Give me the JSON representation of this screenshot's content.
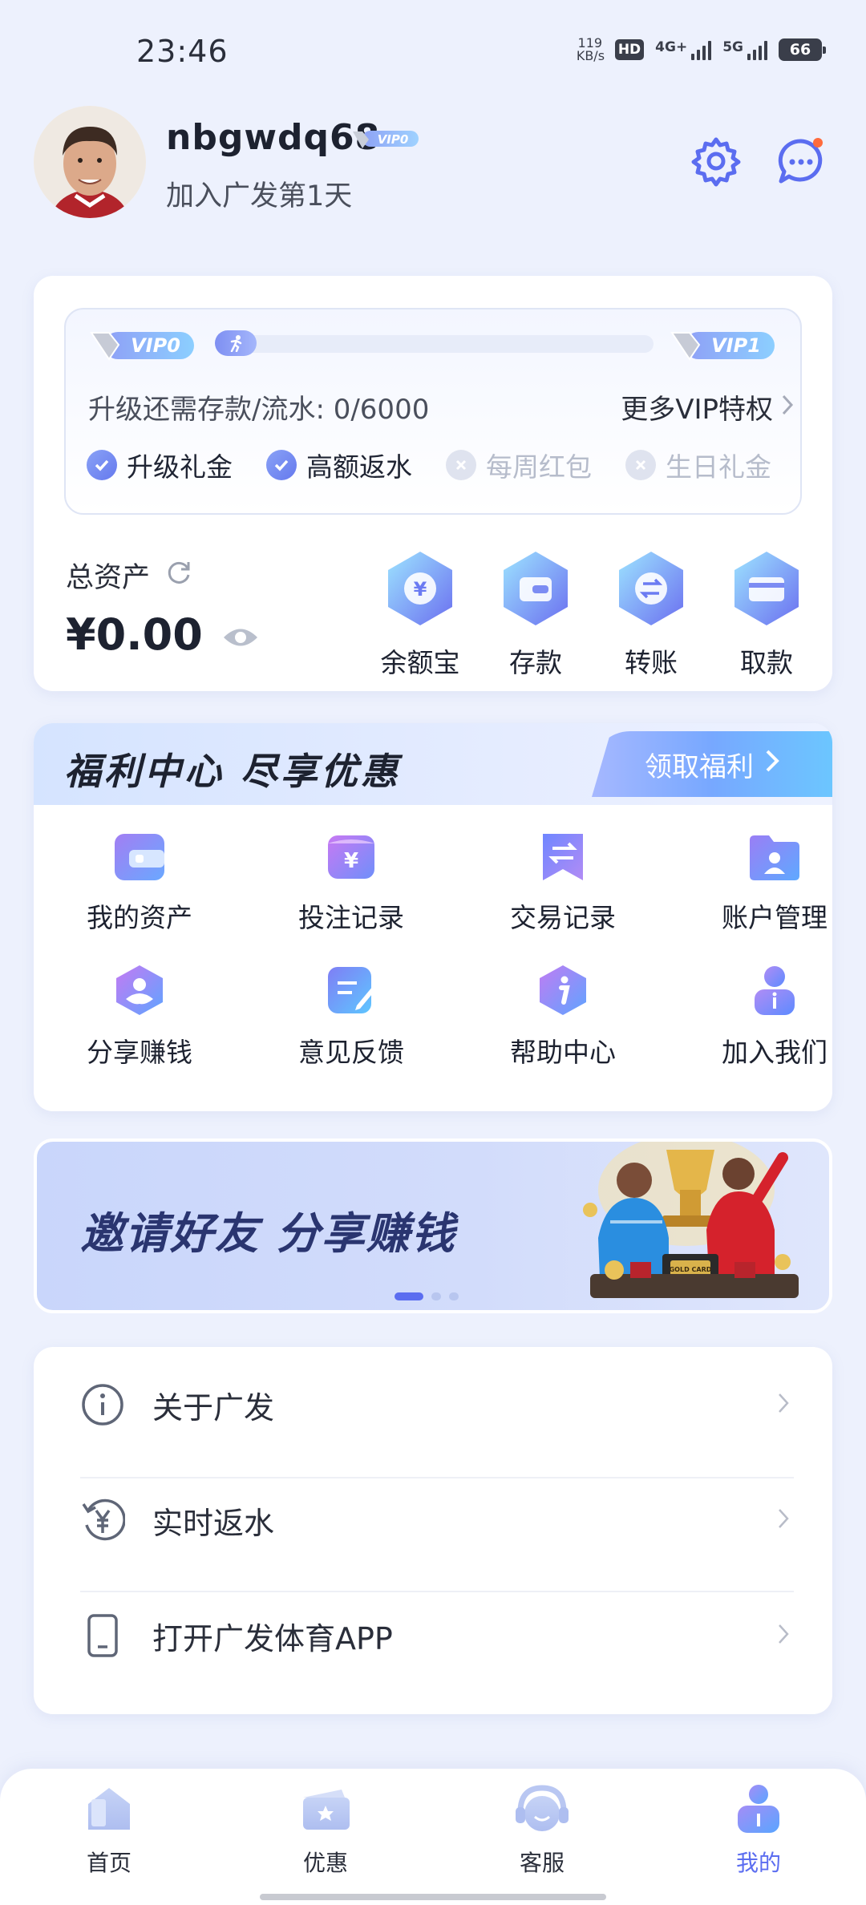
{
  "status_bar": {
    "time": "23:46",
    "net_speed_value": "119",
    "net_speed_unit": "KB/s",
    "hd_label": "HD",
    "sim1": "4G+",
    "sim2": "5G",
    "battery": "66"
  },
  "profile": {
    "username": "nbgwdq68",
    "vip_badge": "VIP0",
    "joined": "加入广发第1天"
  },
  "vip": {
    "current_badge": "VIP0",
    "next_badge": "VIP1",
    "progress_fraction": 0.0,
    "requirement_label": "升级还需存款/流水: 0/6000",
    "more_label": "更多VIP特权",
    "perks": [
      {
        "label": "升级礼金",
        "enabled": true
      },
      {
        "label": "高额返水",
        "enabled": true
      },
      {
        "label": "每周红包",
        "enabled": false
      },
      {
        "label": "生日礼金",
        "enabled": false
      }
    ]
  },
  "assets": {
    "label": "总资产",
    "value": "¥0.00"
  },
  "actions": [
    {
      "label": "余额宝",
      "icon": "yuan-icon"
    },
    {
      "label": "存款",
      "icon": "wallet-icon"
    },
    {
      "label": "转账",
      "icon": "transfer-icon"
    },
    {
      "label": "取款",
      "icon": "card-icon"
    }
  ],
  "welfare": {
    "title": "福利中心  尽享优惠",
    "button": "领取福利",
    "items": [
      {
        "label": "我的资产",
        "icon": "wallet-icon"
      },
      {
        "label": "投注记录",
        "icon": "bet-record-icon"
      },
      {
        "label": "交易记录",
        "icon": "transaction-icon"
      },
      {
        "label": "账户管理",
        "icon": "folder-user-icon"
      },
      {
        "label": "分享赚钱",
        "icon": "share-icon"
      },
      {
        "label": "意见反馈",
        "icon": "feedback-icon"
      },
      {
        "label": "帮助中心",
        "icon": "info-icon"
      },
      {
        "label": "加入我们",
        "icon": "join-icon"
      }
    ]
  },
  "banner": {
    "text": "邀请好友 分享赚钱",
    "card_text": "GOLD CARD",
    "slide_count": 3,
    "active_slide": 0
  },
  "menu": [
    {
      "label": "关于广发",
      "icon": "info-circle-icon"
    },
    {
      "label": "实时返水",
      "icon": "rebate-icon"
    },
    {
      "label": "打开广发体育APP",
      "icon": "phone-icon"
    }
  ],
  "nav": [
    {
      "label": "首页",
      "icon": "home-icon",
      "active": false
    },
    {
      "label": "优惠",
      "icon": "ticket-icon",
      "active": false
    },
    {
      "label": "客服",
      "icon": "headset-icon",
      "active": false
    },
    {
      "label": "我的",
      "icon": "user-icon",
      "active": true
    }
  ],
  "colors": {
    "accent": "#5b6df0",
    "background": "#edf1fd",
    "disabled": "#b6bccb"
  }
}
